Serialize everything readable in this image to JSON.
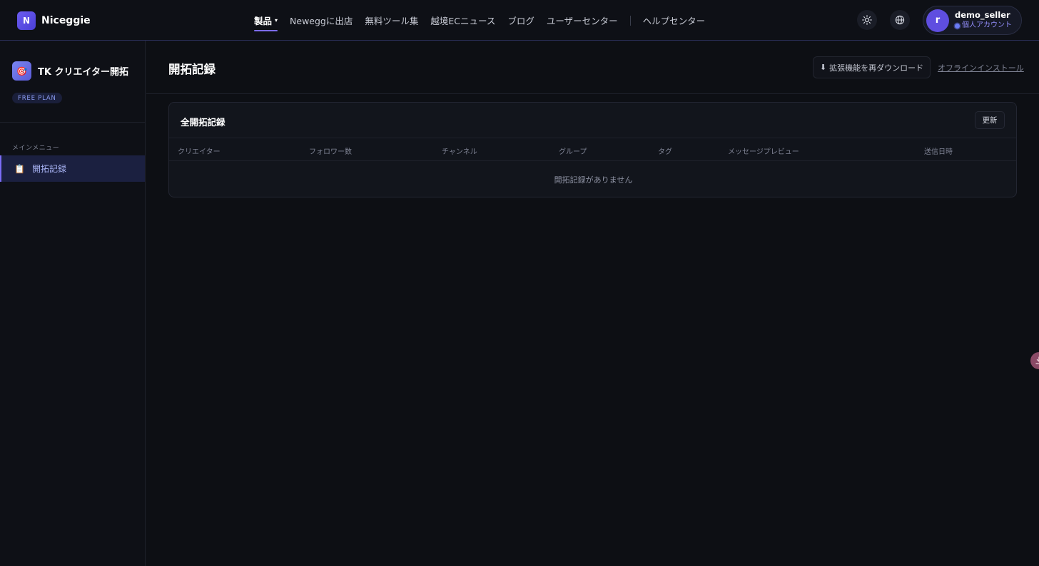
{
  "brand": {
    "logo_letter": "N",
    "name": "Niceggie"
  },
  "nav": {
    "items": [
      {
        "label": "製品",
        "active": true,
        "has_caret": true
      },
      {
        "label": "Neweggに出店"
      },
      {
        "label": "無料ツール集"
      },
      {
        "label": "越境ECニュース"
      },
      {
        "label": "ブログ"
      },
      {
        "label": "ユーザーセンター"
      },
      {
        "label": "ヘルプセンター"
      }
    ],
    "caret": "▾"
  },
  "header_icons": {
    "theme": "sun-icon",
    "language": "globe-icon"
  },
  "user": {
    "avatar_letter": "r",
    "name": "demo_seller",
    "account_type": "個人アカウント"
  },
  "sidebar": {
    "app_icon": "🎯",
    "app_title": "TK クリエイター開拓",
    "plan": "FREE PLAN",
    "section_label": "メインメニュー",
    "items": [
      {
        "icon": "📋",
        "label": "開拓記録",
        "active": true
      }
    ]
  },
  "main": {
    "title": "開拓記録",
    "download_icon": "⬇",
    "download_label": "拡張機能を再ダウンロード",
    "offline_link": "オフラインインストール",
    "card": {
      "title": "全開拓記録",
      "refresh_label": "更新",
      "columns": [
        "クリエイター",
        "フォロワー数",
        "チャンネル",
        "グループ",
        "タグ",
        "メッセージプレビュー",
        "送信日時"
      ],
      "empty_text": "開拓記録がありません"
    }
  },
  "colors": {
    "accent": "#7c6cf5",
    "background": "#0d0f14",
    "active_item_bg": "#1b2040"
  }
}
